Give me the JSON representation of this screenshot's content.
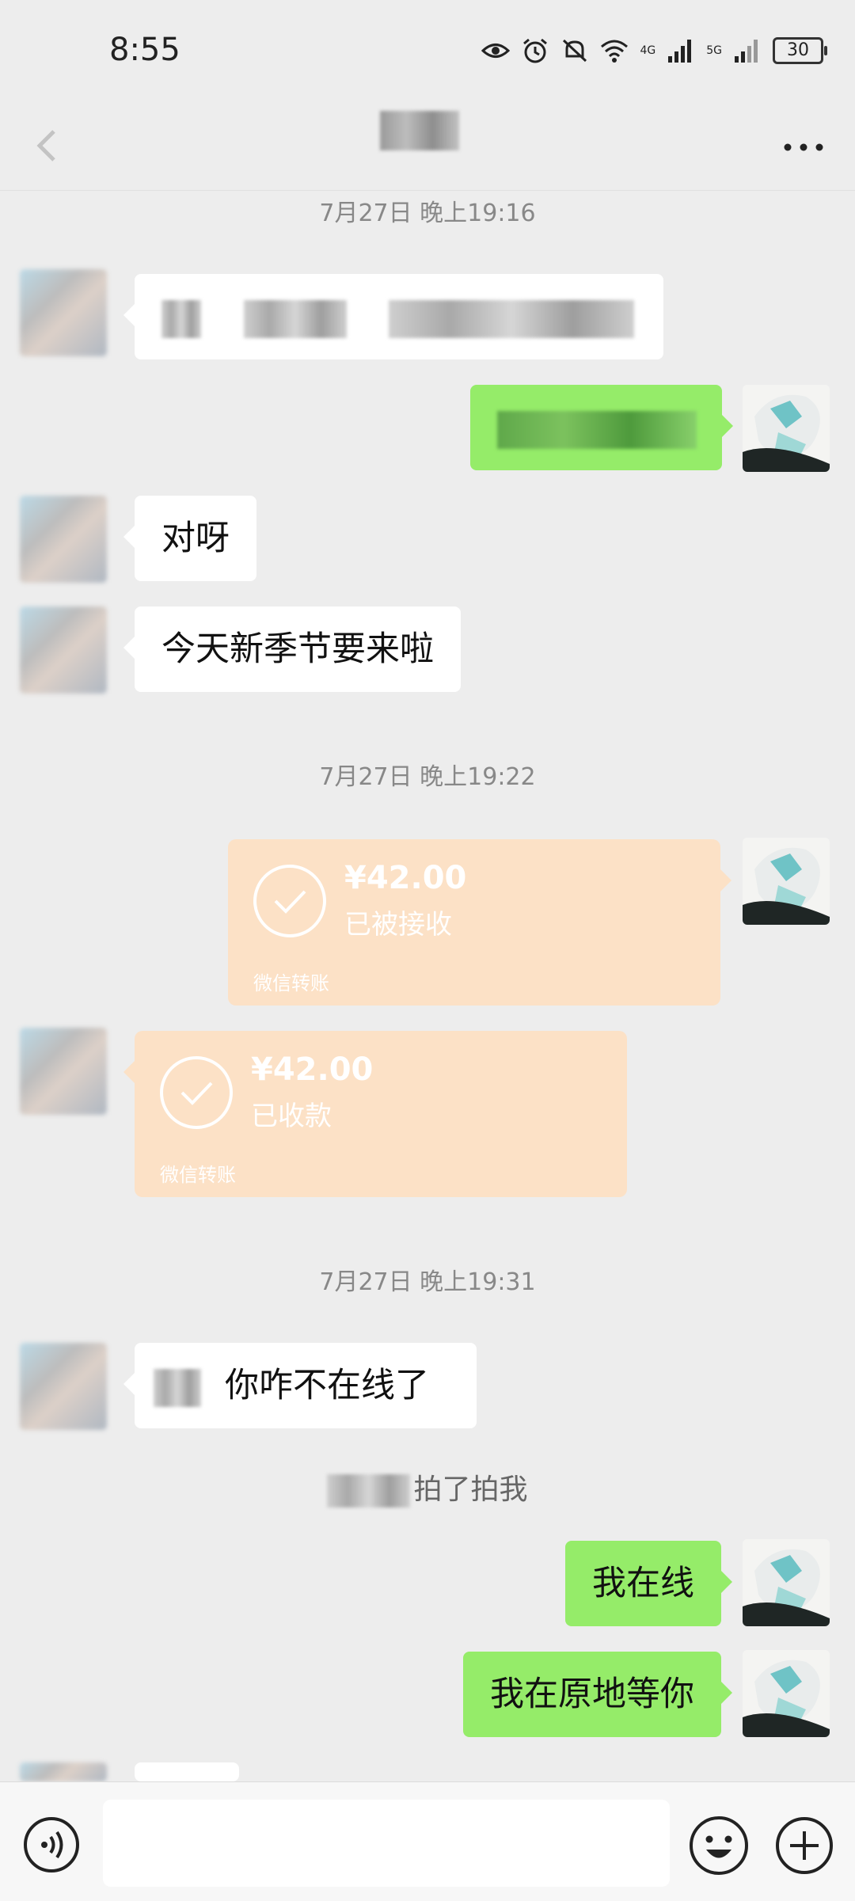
{
  "status": {
    "time": "8:55",
    "network_1": "4G",
    "network_2": "5G",
    "battery": "30"
  },
  "header": {
    "title": "",
    "more_icon": "more-dots-icon",
    "back_icon": "back-arrow-icon"
  },
  "timestamps": [
    "7月27日 晚上19:16",
    "7月27日 晚上19:22",
    "7月27日 晚上19:31"
  ],
  "messages": {
    "m3": "对呀",
    "m4": "今天新季节要来啦",
    "m7_text": "你咋不在线了",
    "m9": "我在线",
    "m10": "我在原地等你"
  },
  "transfers": [
    {
      "amount": "¥42.00",
      "status": "已被接收",
      "label": "微信转账"
    },
    {
      "amount": "¥42.00",
      "status": "已收款",
      "label": "微信转账"
    }
  ],
  "pat_text": "拍了拍我",
  "colors": {
    "background": "#ededed",
    "outgoing_bubble": "#95ec69",
    "incoming_bubble": "#ffffff",
    "transfer_card": "#fce1c6"
  },
  "input_bar": {
    "voice_icon": "voice-icon",
    "emoji_icon": "emoji-icon",
    "plus_icon": "plus-icon"
  }
}
